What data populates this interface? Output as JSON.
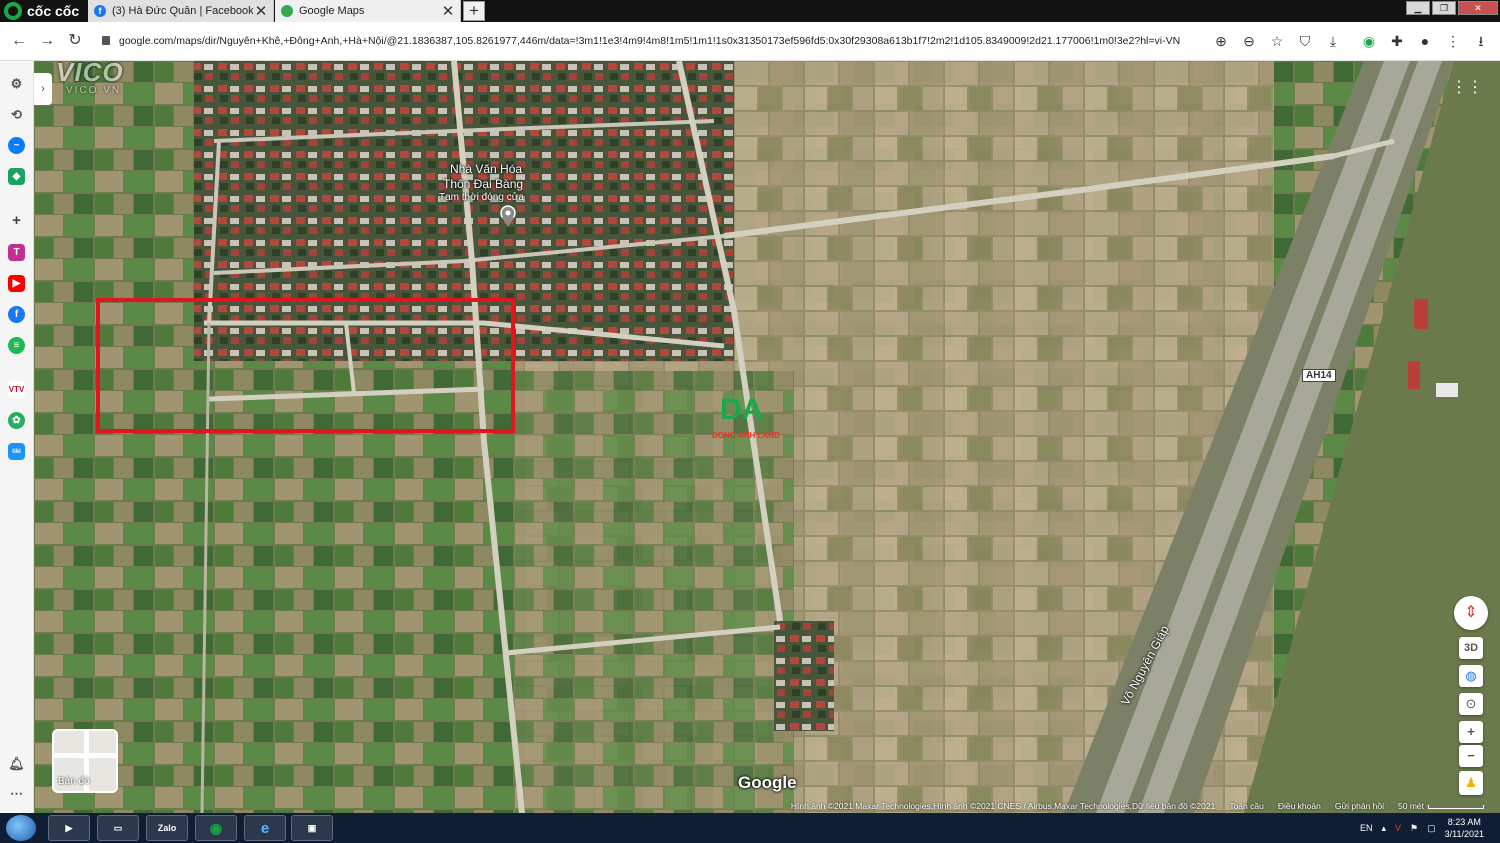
{
  "browser": {
    "brand": "cốc cốc",
    "tabs": [
      {
        "label": "(3) Hà Đức Quân | Facebook",
        "icon": "facebook-icon",
        "close": "✕"
      },
      {
        "label": "Google Maps",
        "icon": "google-maps-pin-icon",
        "close": "✕"
      }
    ],
    "new_tab": "+",
    "url": "google.com/maps/dir/Nguyên+Khê,+Đông+Anh,+Hà+Nội/@21.1836387,105.8261977,446m/data=!3m1!1e3!4m9!4m8!1m5!1m1!1s0x31350173ef596fd5:0x30f29308a613b1f7!2m2!1d105.8349009!2d21.177006!1m0!3e2?hl=vi-VN"
  },
  "map": {
    "watermark_top": "VICO",
    "watermark_sub": "VICO.VN",
    "poi": {
      "name_line1": "Nhà Văn Hóa",
      "name_line2": "Thôn Đại Bàng",
      "status": "Tạm thời đóng cửa"
    },
    "overlay_logo": {
      "letters": "DA",
      "text": "DONG ANH LAND"
    },
    "road_shield": "AH14",
    "road_name": "Võ Nguyên Giáp",
    "google_logo": "Google",
    "layer_label": "Bản đồ",
    "tilt_label": "3D",
    "highlight_color": "#e0151d",
    "attribution": "Hình ảnh ©2021 Maxar Technologies,Hình ảnh ©2021 CNES / Airbus,Maxar Technologies,Dữ liệu bản đồ ©2021",
    "links": [
      "Toàn cầu",
      "Điều khoản",
      "Gửi phản hồi"
    ],
    "scale": "50 mét"
  },
  "taskbar": {
    "zalo": "Zalo",
    "lang": "EN",
    "time": "8:23 AM",
    "date": "3/11/2021"
  }
}
